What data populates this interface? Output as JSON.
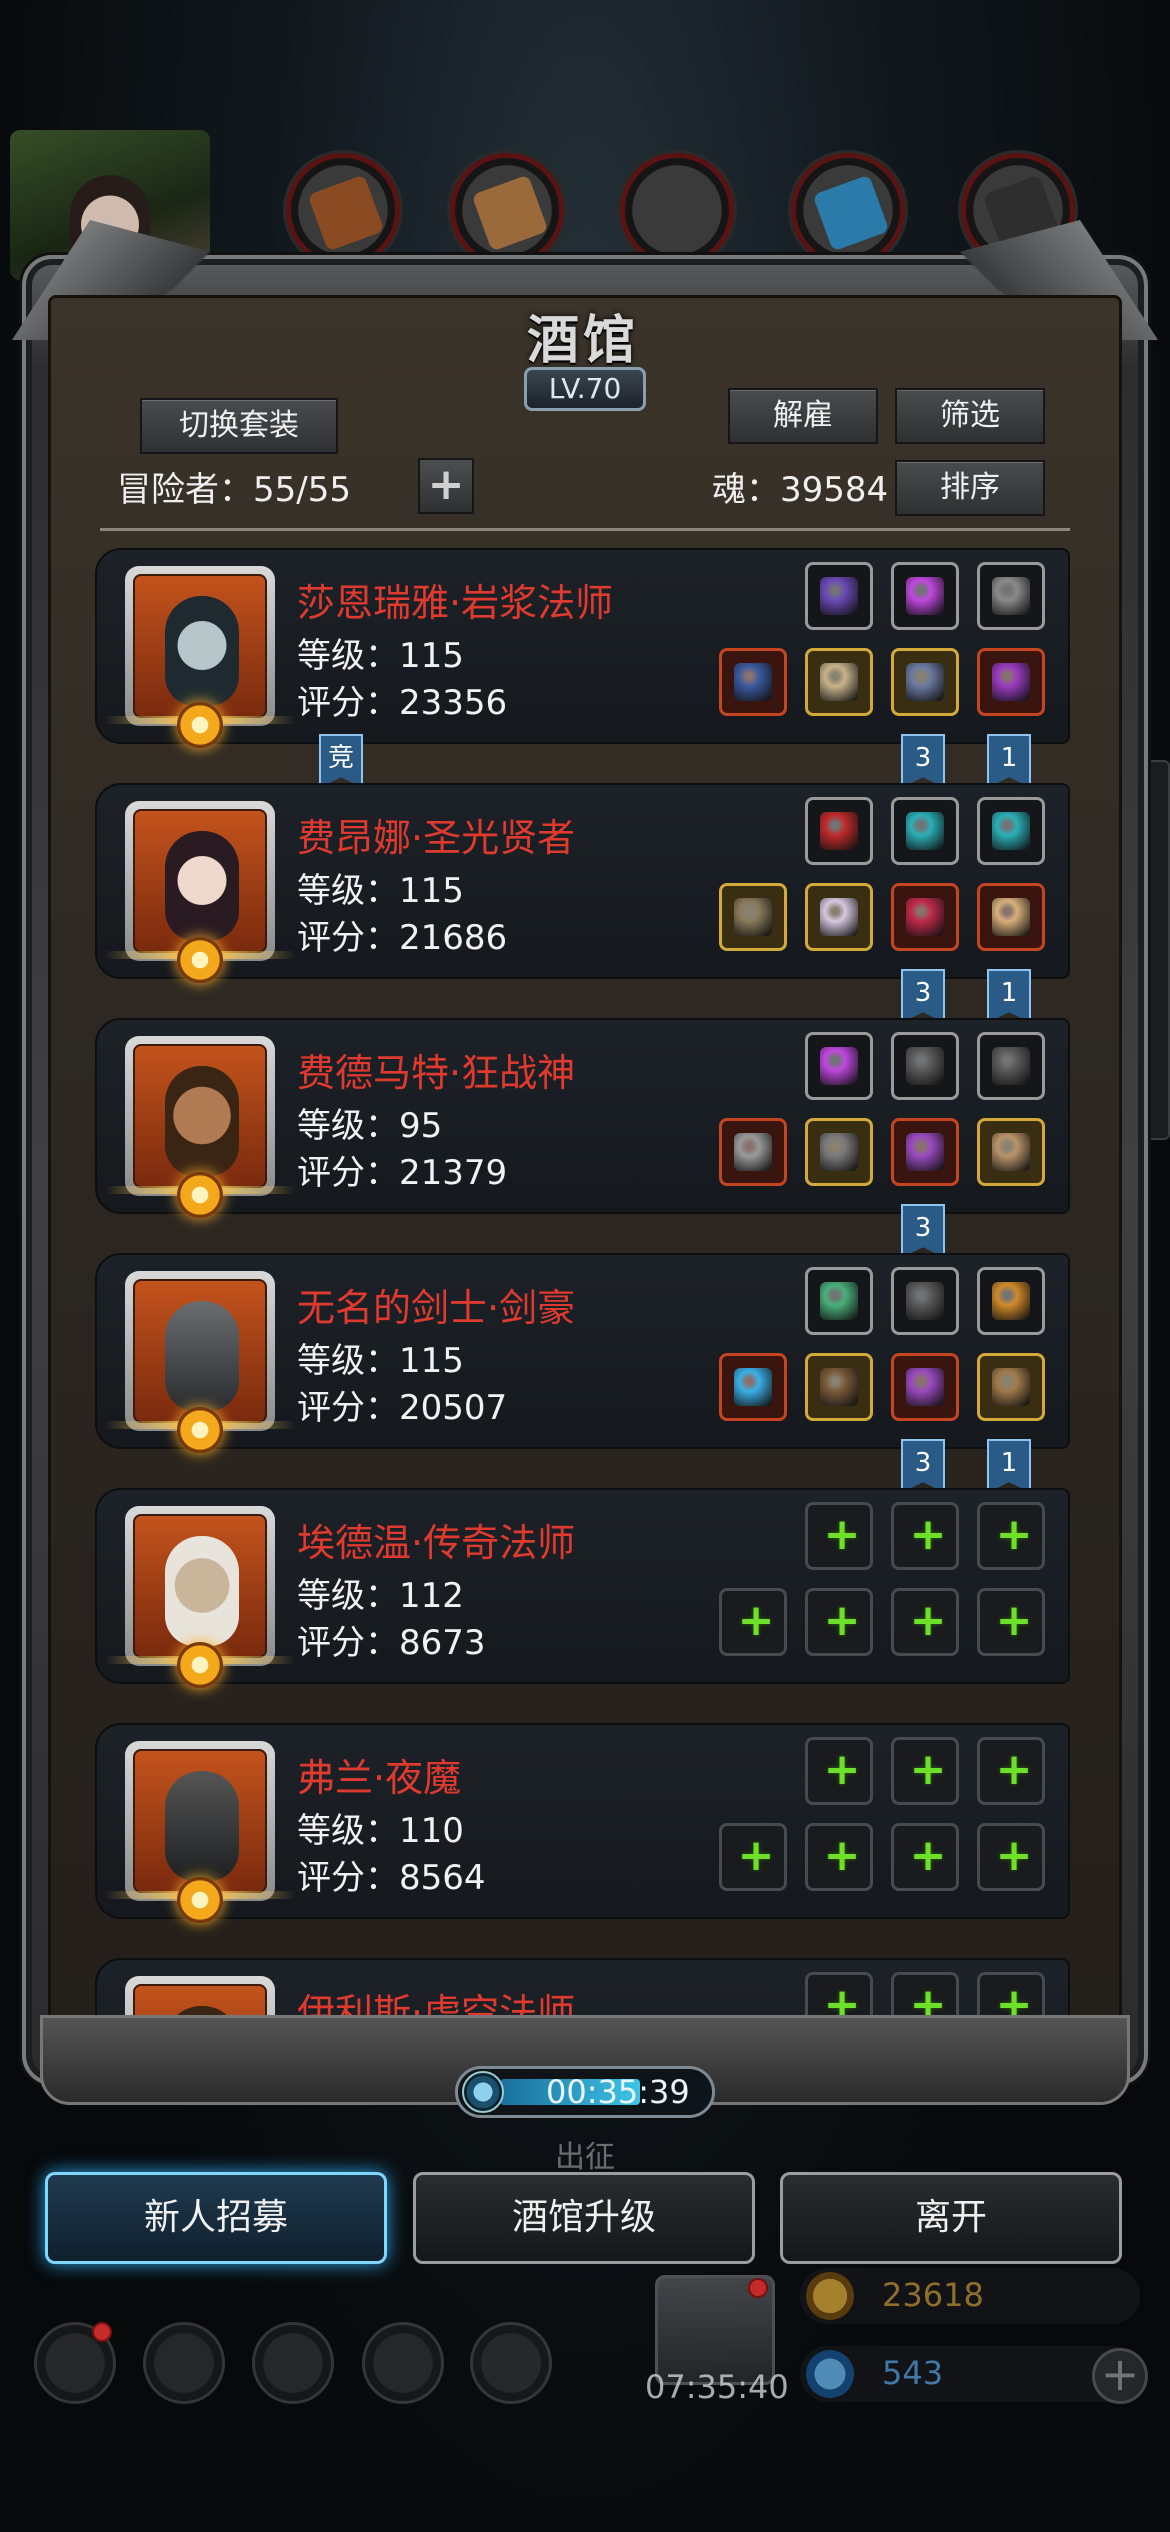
{
  "tavern": {
    "title": "酒馆",
    "level": "LV.70",
    "switch_set_label": "切换套装",
    "dismiss_label": "解雇",
    "filter_label": "筛选",
    "sort_label": "排序",
    "adventurer_count": "冒险者：55/55",
    "soul": "魂：39584"
  },
  "heroes": [
    {
      "name": "莎恩瑞雅·岩浆法师",
      "level": "等级：115",
      "score": "评分：23356",
      "portrait_color": "#3a4a55",
      "top_slots": [
        "purple-gem-icon",
        "purple-crystal-icon",
        "mask-icon"
      ],
      "bottom_slots": [
        "staff-icon",
        "robe-icon",
        "amulet-icon",
        "ring-icon"
      ],
      "tags": [
        {
          "text": "竞"
        },
        {
          "text": "3"
        },
        {
          "text": "1"
        }
      ]
    },
    {
      "name": "费昂娜·圣光贤者",
      "level": "等级：115",
      "score": "评分：21686",
      "portrait_color": "#d8b8a8",
      "top_slots": [
        "red-bag-icon",
        "teal-gem-icon",
        "teal-gem-icon"
      ],
      "bottom_slots": [
        "spear-icon",
        "cloak-icon",
        "potion-icon",
        "medal-icon"
      ],
      "tags": [
        {
          "text": "3"
        },
        {
          "text": "1"
        }
      ]
    },
    {
      "name": "费德马特·狂战神",
      "level": "等级：95",
      "score": "评分：21379",
      "portrait_color": "#8a5a3a",
      "top_slots": [
        "purple-crystal-icon",
        "feather-icon",
        "feather-icon"
      ],
      "bottom_slots": [
        "axe-icon",
        "armor-icon",
        "helmet-icon",
        "bracer-icon"
      ],
      "tags": [
        {
          "text": "3"
        }
      ]
    },
    {
      "name": "无名的剑士·剑豪",
      "level": "等级：115",
      "score": "评分：20507",
      "portrait_color": "#3a3d40",
      "top_slots": [
        "green-crystal-icon",
        "feather-icon",
        "emblem-icon"
      ],
      "bottom_slots": [
        "sword-icon",
        "boots-icon",
        "helmet-icon",
        "scroll-icon"
      ],
      "tags": [
        {
          "text": "3"
        },
        {
          "text": "1"
        }
      ]
    },
    {
      "name": "埃德温·传奇法师",
      "level": "等级：112",
      "score": "评分：8673",
      "portrait_color": "#b8a890",
      "top_slots": [
        "empty",
        "empty",
        "empty"
      ],
      "bottom_slots": [
        "empty",
        "empty",
        "empty",
        "empty"
      ],
      "tags": []
    },
    {
      "name": "弗兰·夜魔",
      "level": "等级：110",
      "score": "评分：8564",
      "portrait_color": "#2a2d30",
      "top_slots": [
        "empty",
        "empty",
        "empty"
      ],
      "bottom_slots": [
        "empty",
        "empty",
        "empty",
        "empty"
      ],
      "tags": []
    },
    {
      "name": "伊利斯·虚空法师",
      "level": "",
      "score": "",
      "portrait_color": "#8a5a3a",
      "top_slots": [
        "empty",
        "empty",
        "empty"
      ],
      "bottom_slots": [],
      "tags": []
    }
  ],
  "timer": "00:35:39",
  "buttons": {
    "recruit": "新人招募",
    "upgrade": "酒馆升级",
    "leave": "离开"
  },
  "background": {
    "ghost_text": "出征",
    "chest_timer": "07:35:40",
    "gold": "23618",
    "gems": "543"
  },
  "colors": {
    "hero_name": "#e03a2f",
    "accent_blue": "#7fd6ff",
    "add_green": "#6fe02a"
  }
}
